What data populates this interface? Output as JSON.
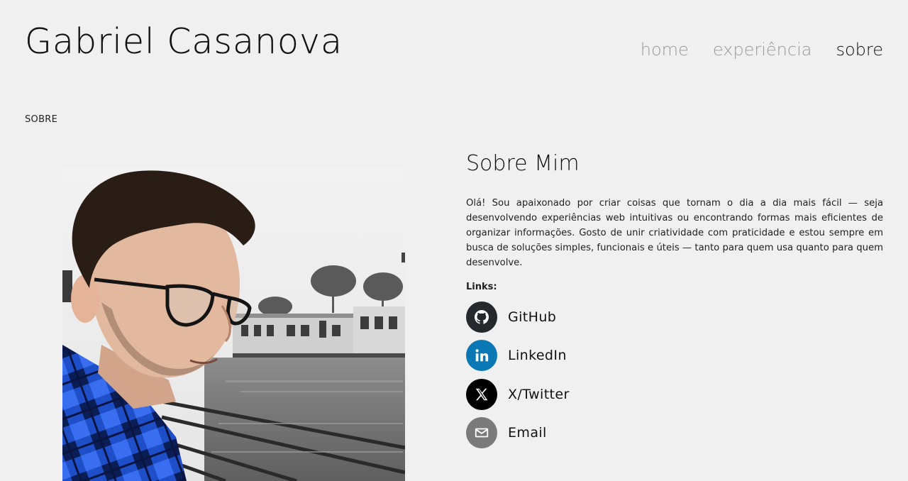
{
  "header": {
    "site_title": "Gabriel Casanova",
    "nav": [
      {
        "label": "home",
        "active": false
      },
      {
        "label": "experiência",
        "active": false
      },
      {
        "label": "sobre",
        "active": true
      }
    ]
  },
  "section_label": "SOBRE",
  "about": {
    "title": "Sobre Mim",
    "paragraph": "Olá! Sou apaixonado por criar coisas que tornam o dia a dia mais fácil — seja desenvolvendo experiências web intuitivas ou encontrando formas mais eficientes de organizar informações. Gosto de unir criatividade com praticidade e estou sempre em busca de soluções simples, funcionais e úteis — tanto para quem usa quanto para quem desenvolve.",
    "links_label": "Links:",
    "links": [
      {
        "label": "GitHub",
        "icon": "github-icon",
        "color": "#24292e"
      },
      {
        "label": "LinkedIn",
        "icon": "linkedin-icon",
        "color": "#0a78b5"
      },
      {
        "label": "X/Twitter",
        "icon": "x-icon",
        "color": "#000000"
      },
      {
        "label": "Email",
        "icon": "mail-icon",
        "color": "#7a7a7a"
      }
    ]
  },
  "colors": {
    "background": "#f0f0f0",
    "text": "#111111",
    "nav_inactive": "#9a9a9a"
  }
}
